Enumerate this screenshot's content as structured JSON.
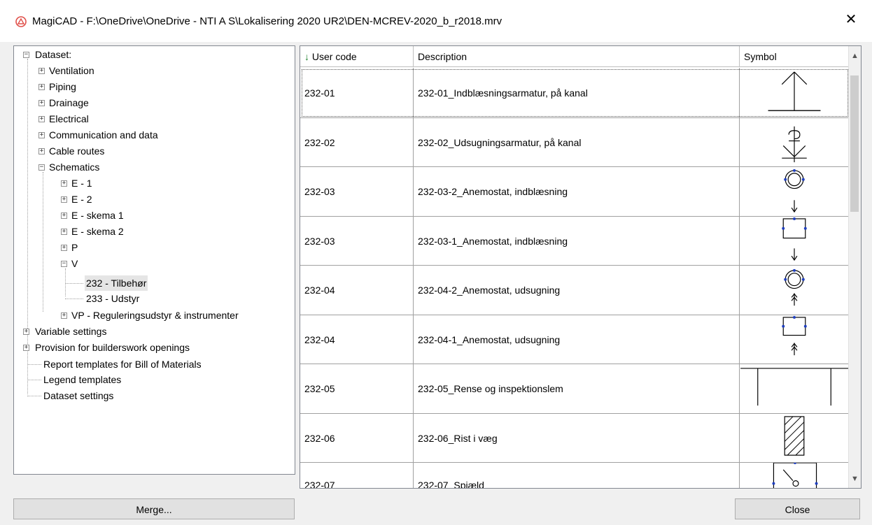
{
  "window": {
    "title": "MagiCAD - F:\\OneDrive\\OneDrive - NTI A S\\Lokalisering 2020 UR2\\DEN-MCREV-2020_b_r2018.mrv"
  },
  "tree": {
    "root": "Dataset:",
    "items": [
      {
        "label": "Ventilation"
      },
      {
        "label": "Piping"
      },
      {
        "label": "Drainage"
      },
      {
        "label": "Electrical"
      },
      {
        "label": "Communication and data"
      },
      {
        "label": "Cable routes"
      },
      {
        "label": "Schematics"
      },
      {
        "label": "E - 1"
      },
      {
        "label": "E - 2"
      },
      {
        "label": "E - skema 1"
      },
      {
        "label": "E - skema 2"
      },
      {
        "label": "P"
      },
      {
        "label": "V"
      },
      {
        "label": "232 - Tilbehør"
      },
      {
        "label": "233 - Udstyr"
      },
      {
        "label": "VP - Reguleringsudstyr & instrumenter"
      },
      {
        "label": "Variable settings"
      },
      {
        "label": "Provision for builderswork openings"
      },
      {
        "label": "Report templates for Bill of Materials"
      },
      {
        "label": "Legend templates"
      },
      {
        "label": "Dataset settings"
      }
    ]
  },
  "grid": {
    "columns": {
      "user_code": "User code",
      "description": "Description",
      "symbol": "Symbol"
    },
    "sort_indicator": "↓",
    "rows": [
      {
        "code": "232-01",
        "desc": "232-01_Indblæsningsarmatur, på kanal"
      },
      {
        "code": "232-02",
        "desc": "232-02_Udsugningsarmatur, på kanal"
      },
      {
        "code": "232-03",
        "desc": "232-03-2_Anemostat, indblæsning"
      },
      {
        "code": "232-03",
        "desc": "232-03-1_Anemostat, indblæsning"
      },
      {
        "code": "232-04",
        "desc": "232-04-2_Anemostat, udsugning"
      },
      {
        "code": "232-04",
        "desc": "232-04-1_Anemostat, udsugning"
      },
      {
        "code": "232-05",
        "desc": "232-05_Rense og inspektionslem"
      },
      {
        "code": "232-06",
        "desc": "232-06_Rist i væg"
      },
      {
        "code": "232-07",
        "desc": "232-07_Spjæld"
      }
    ]
  },
  "buttons": {
    "merge": "Merge...",
    "close": "Close"
  },
  "colors": {
    "sort_arrow": "#1a7f2a",
    "connector_dot": "#1f3fbf"
  }
}
